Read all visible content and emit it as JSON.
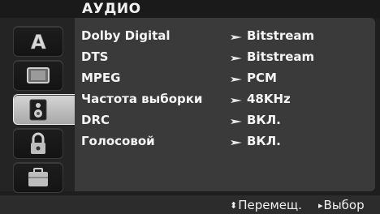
{
  "menu": {
    "title": "АУДИО",
    "selected_tab": 2,
    "tabs": [
      {
        "icon": "letter-a-icon",
        "label": "A"
      },
      {
        "icon": "tv-screen-icon"
      },
      {
        "icon": "speaker-icon"
      },
      {
        "icon": "padlock-icon"
      },
      {
        "icon": "briefcase-icon"
      }
    ],
    "rows": [
      {
        "label": "Dolby Digital",
        "value": "Bitstream"
      },
      {
        "label": "DTS",
        "value": "Bitstream"
      },
      {
        "label": "MPEG",
        "value": "PCM"
      },
      {
        "label": "Частота выборки",
        "value": "48KHz"
      },
      {
        "label": "DRC",
        "value": "ВКЛ."
      },
      {
        "label": "Голосовой",
        "value": "ВКЛ."
      }
    ]
  },
  "help": {
    "move_icon": "up-down-arrows-icon",
    "move_label": "Перемещ.",
    "select_icon": "right-triangle-icon",
    "select_label": "Выбор"
  }
}
